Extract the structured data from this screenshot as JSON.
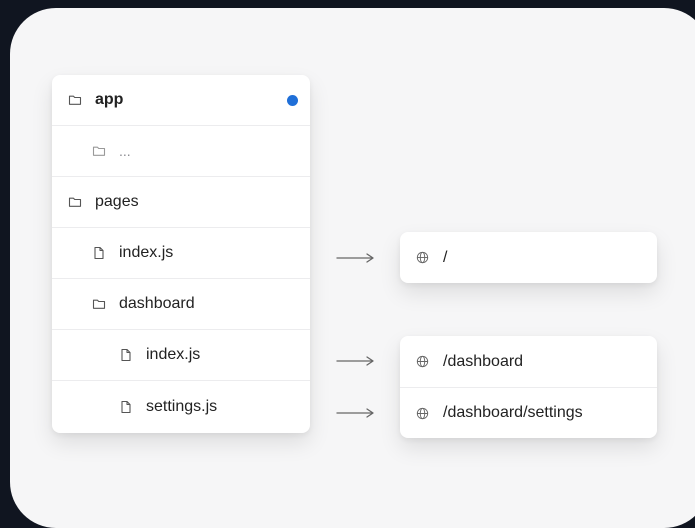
{
  "tree": [
    {
      "label": "app",
      "type": "folder",
      "level": 0,
      "bold": true,
      "badge": true
    },
    {
      "label": "...",
      "type": "folder",
      "level": 1,
      "muted": true
    },
    {
      "label": "pages",
      "type": "folder",
      "level": 0
    },
    {
      "label": "index.js",
      "type": "file",
      "level": 1
    },
    {
      "label": "dashboard",
      "type": "folder",
      "level": 1
    },
    {
      "label": "index.js",
      "type": "file",
      "level": 2
    },
    {
      "label": "settings.js",
      "type": "file",
      "level": 2
    }
  ],
  "routes": {
    "root": "/",
    "dashboard": "/dashboard",
    "settings": "/dashboard/settings"
  },
  "colors": {
    "background": "#101520",
    "canvas": "#f6f6f7",
    "badge": "#1f6fd8"
  }
}
